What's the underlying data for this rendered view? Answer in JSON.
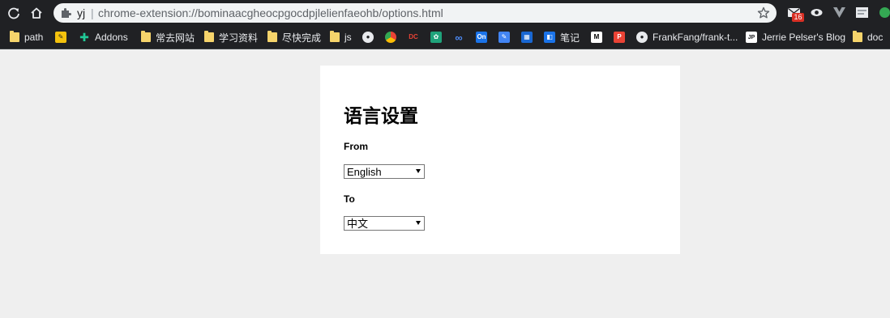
{
  "browser": {
    "omnibox": {
      "host": "yj",
      "separator": "|",
      "url": "chrome-extension://bominaacgheocpgocdpjlelienfaeohb/options.html"
    },
    "extensions": {
      "mail_badge_count": "16"
    },
    "bookmarks": [
      {
        "label": "path",
        "icon": "folder-icon"
      },
      {
        "label": "",
        "icon": "yellow-pen-icon"
      },
      {
        "label": "Addons",
        "icon": "puzzle-icon"
      },
      {
        "label": "常去网站",
        "icon": "folder-icon"
      },
      {
        "label": "学习资料",
        "icon": "folder-icon"
      },
      {
        "label": "尽快完成",
        "icon": "folder-icon"
      },
      {
        "label": "js",
        "icon": "folder-icon"
      },
      {
        "label": "笔记",
        "icon": "blue-site-icon"
      },
      {
        "label": "FrankFang/frank-t...",
        "icon": "github-icon"
      },
      {
        "label": "Jerrie Pelser's Blog",
        "icon": "jp-icon"
      },
      {
        "label": "doc",
        "icon": "folder-icon"
      }
    ],
    "favicon_badges": {
      "on": "On",
      "medium": "M",
      "jp": "JP",
      "dc": "DC",
      "p": "P"
    }
  },
  "options": {
    "title": "语言设置",
    "from_label": "From",
    "from_value": "English",
    "to_label": "To",
    "to_value": "中文"
  },
  "colors": {
    "toolbar_bg": "#202124",
    "page_bg": "#efefef",
    "card_bg": "#ffffff",
    "folder": "#f6d46b"
  }
}
